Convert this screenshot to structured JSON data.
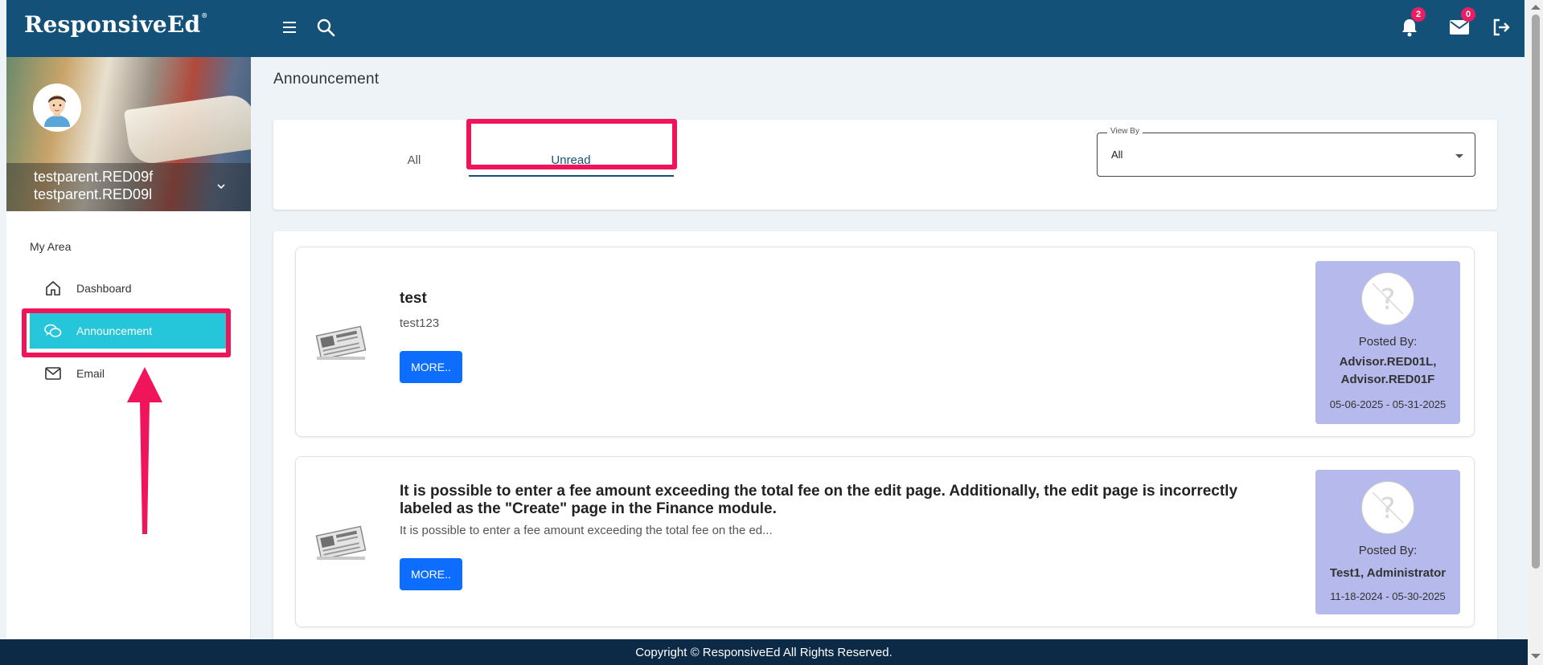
{
  "brand": {
    "name": "ResponsiveEd",
    "mark": "®"
  },
  "header": {
    "notifications_count": "2",
    "messages_count": "0",
    "icons": [
      "menu-icon",
      "search-icon",
      "bell-icon",
      "mail-icon",
      "logout-icon"
    ]
  },
  "profile": {
    "name_line1": "testparent.RED09f",
    "name_line2": "testparent.RED09l"
  },
  "sidebar": {
    "section_label": "My Area",
    "items": [
      {
        "label": "Dashboard",
        "icon": "home-icon",
        "active": false
      },
      {
        "label": "Announcement",
        "icon": "chat-icon",
        "active": true
      },
      {
        "label": "Email",
        "icon": "mail-icon",
        "active": false
      }
    ]
  },
  "page": {
    "title": "Announcement"
  },
  "tabs": [
    {
      "label": "All",
      "selected": false
    },
    {
      "label": "Unread",
      "selected": true
    }
  ],
  "view_by": {
    "label": "View By",
    "value": "All"
  },
  "announcements": [
    {
      "title": "test",
      "summary": "test123",
      "button_label": "MORE..",
      "posted_by_label": "Posted By:",
      "posted_by": "Advisor.RED01L, Advisor.RED01F",
      "dates": "05-06-2025 - 05-31-2025"
    },
    {
      "title": "It is possible to enter a fee amount exceeding the total fee on the edit page. Additionally, the edit page is incorrectly labeled as the \"Create\" page in the Finance module.",
      "summary": "It is possible to enter a fee amount exceeding the total fee on the ed...",
      "button_label": "MORE..",
      "posted_by_label": "Posted By:",
      "posted_by": "Test1, Administrator",
      "dates": "11-18-2024 - 05-30-2025"
    }
  ],
  "footer": {
    "text": "Copyright © ResponsiveEd All Rights Reserved."
  },
  "colors": {
    "header_bg": "#135179",
    "active_nav": "#26c6da",
    "highlight": "#f0145a",
    "button": "#0d6efd",
    "poster_bg": "#b6b9ec",
    "footer_bg": "#0c2a45"
  }
}
